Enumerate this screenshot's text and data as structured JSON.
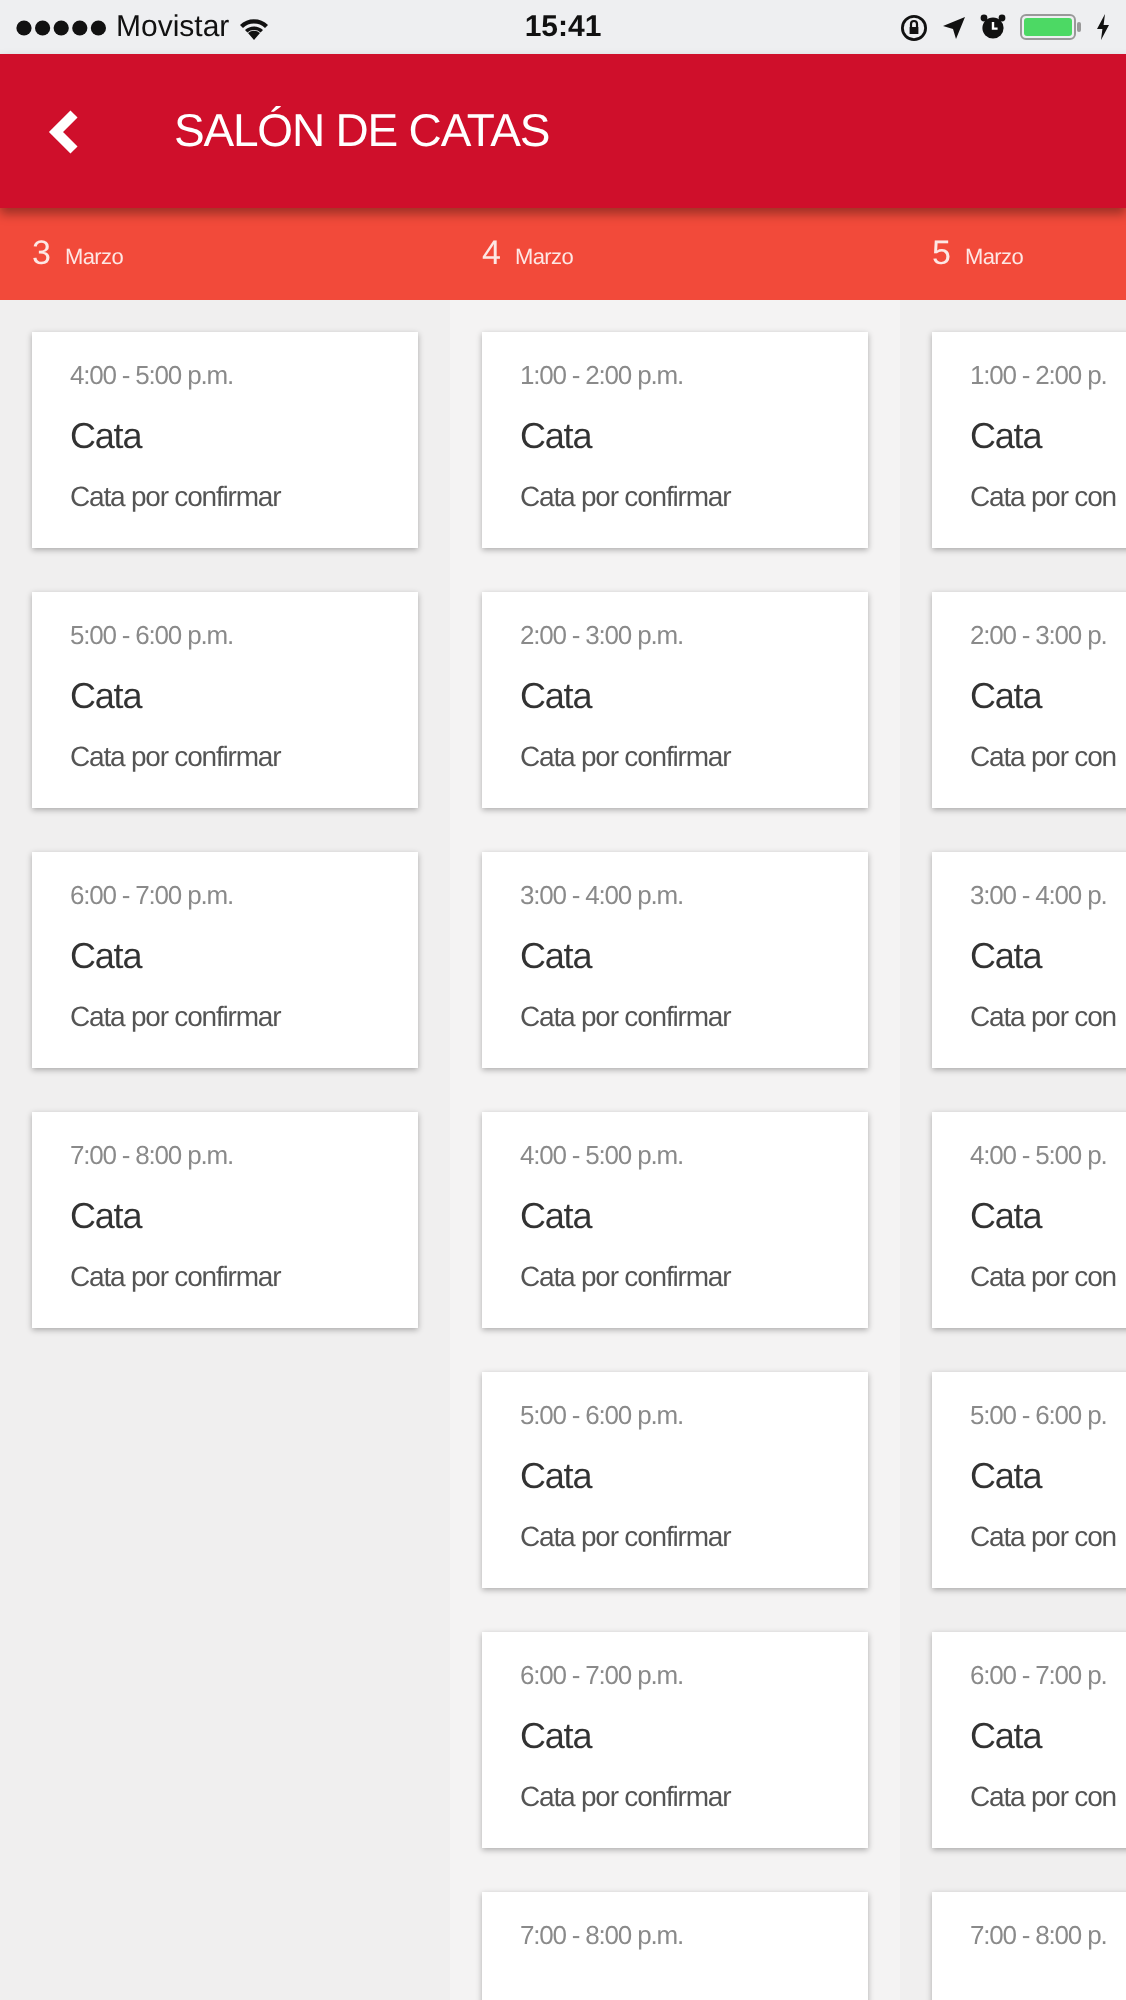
{
  "status_bar": {
    "carrier": "Movistar",
    "time": "15:41"
  },
  "header": {
    "title": "SALÓN DE CATAS"
  },
  "days": [
    {
      "day": "3",
      "month": "Marzo",
      "slots": [
        {
          "time": "4:00 - 5:00 p.m.",
          "title": "Cata",
          "status": "Cata por confirmar"
        },
        {
          "time": "5:00 - 6:00 p.m.",
          "title": "Cata",
          "status": "Cata por confirmar"
        },
        {
          "time": "6:00 - 7:00 p.m.",
          "title": "Cata",
          "status": "Cata por confirmar"
        },
        {
          "time": "7:00 - 8:00 p.m.",
          "title": "Cata",
          "status": "Cata por confirmar"
        }
      ]
    },
    {
      "day": "4",
      "month": "Marzo",
      "slots": [
        {
          "time": "1:00 - 2:00 p.m.",
          "title": "Cata",
          "status": "Cata por confirmar"
        },
        {
          "time": "2:00 - 3:00 p.m.",
          "title": "Cata",
          "status": "Cata por confirmar"
        },
        {
          "time": "3:00 - 4:00 p.m.",
          "title": "Cata",
          "status": "Cata por confirmar"
        },
        {
          "time": "4:00 - 5:00 p.m.",
          "title": "Cata",
          "status": "Cata por confirmar"
        },
        {
          "time": "5:00 - 6:00 p.m.",
          "title": "Cata",
          "status": "Cata por confirmar"
        },
        {
          "time": "6:00 - 7:00 p.m.",
          "title": "Cata",
          "status": "Cata por confirmar"
        },
        {
          "time": "7:00 - 8:00 p.m."
        }
      ]
    },
    {
      "day": "5",
      "month": "Marzo",
      "slots": [
        {
          "time": "1:00 - 2:00 p.",
          "title": "Cata",
          "status": "Cata por con"
        },
        {
          "time": "2:00 - 3:00 p.",
          "title": "Cata",
          "status": "Cata por con"
        },
        {
          "time": "3:00 - 4:00 p.",
          "title": "Cata",
          "status": "Cata por con"
        },
        {
          "time": "4:00 - 5:00 p.",
          "title": "Cata",
          "status": "Cata por con"
        },
        {
          "time": "5:00 - 6:00 p.",
          "title": "Cata",
          "status": "Cata por con"
        },
        {
          "time": "6:00 - 7:00 p.",
          "title": "Cata",
          "status": "Cata por con"
        },
        {
          "time": "7:00 - 8:00 p."
        }
      ]
    }
  ]
}
